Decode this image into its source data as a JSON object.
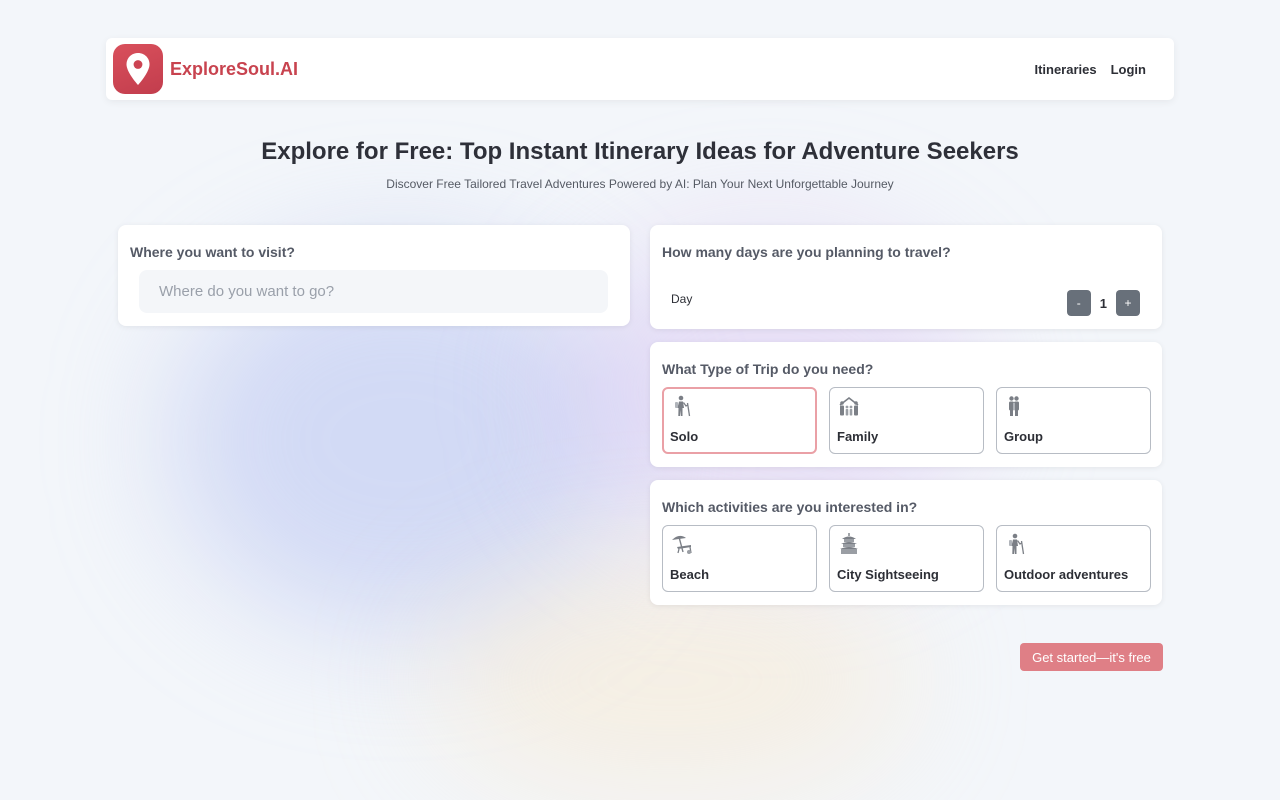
{
  "brand": {
    "name": "ExploreSoul.AI",
    "logo_icon": "map-pin-icon"
  },
  "nav": {
    "items": [
      {
        "label": "Itineraries"
      },
      {
        "label": "Login"
      }
    ]
  },
  "hero": {
    "title": "Explore for Free: Top Instant Itinerary Ideas for Adventure Seekers",
    "subtitle": "Discover Free Tailored Travel Adventures Powered by AI: Plan Your Next Unforgettable Journey"
  },
  "destination": {
    "label": "Where you want to visit?",
    "placeholder": "Where do you want to go?",
    "value": ""
  },
  "days": {
    "label": "How many days are you planning to travel?",
    "unit_label": "Day",
    "value": "1",
    "decrement": "-",
    "increment": "+"
  },
  "trip_type": {
    "label": "What Type of Trip do you need?",
    "options": [
      {
        "label": "Solo",
        "icon": "solo-traveler-icon",
        "selected": true
      },
      {
        "label": "Family",
        "icon": "family-icon",
        "selected": false
      },
      {
        "label": "Group",
        "icon": "group-icon",
        "selected": false
      }
    ]
  },
  "activities": {
    "label": "Which activities are you interested in?",
    "options": [
      {
        "label": "Beach",
        "icon": "beach-icon"
      },
      {
        "label": "City Sightseeing",
        "icon": "temple-icon"
      },
      {
        "label": "Outdoor adventures",
        "icon": "hiker-icon"
      }
    ]
  },
  "cta": {
    "label": "Get started—it's free"
  },
  "colors": {
    "brand": "#c8434f",
    "cta": "#df7f86",
    "selected_border": "#eaa0a6",
    "stepper": "#68707a"
  }
}
